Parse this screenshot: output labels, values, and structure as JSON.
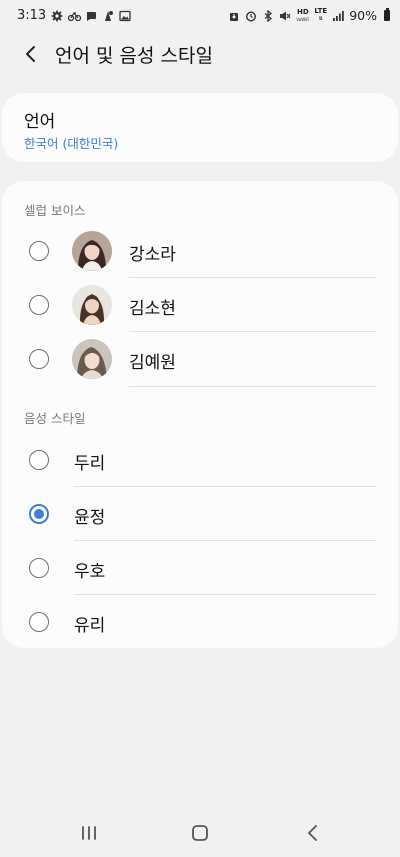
{
  "status_bar": {
    "time": "3:13",
    "network": "HD",
    "network_sub": "VoWiFi",
    "lte": "LTE",
    "battery": "90%"
  },
  "header": {
    "title": "언어 및 음성 스타일"
  },
  "language": {
    "title": "언어",
    "value": "한국어 (대한민국)"
  },
  "celeb_voice": {
    "header": "셀럽 보이스",
    "items": [
      {
        "label": "강소라",
        "checked": false
      },
      {
        "label": "김소현",
        "checked": false
      },
      {
        "label": "김예원",
        "checked": false
      }
    ]
  },
  "voice_style": {
    "header": "음성 스타일",
    "items": [
      {
        "label": "두리",
        "checked": false
      },
      {
        "label": "윤정",
        "checked": true
      },
      {
        "label": "우호",
        "checked": false
      },
      {
        "label": "유리",
        "checked": false
      }
    ]
  },
  "colors": {
    "accent": "#3c7fd6",
    "background": "#f1f1f1",
    "card": "#fcfcfc"
  }
}
